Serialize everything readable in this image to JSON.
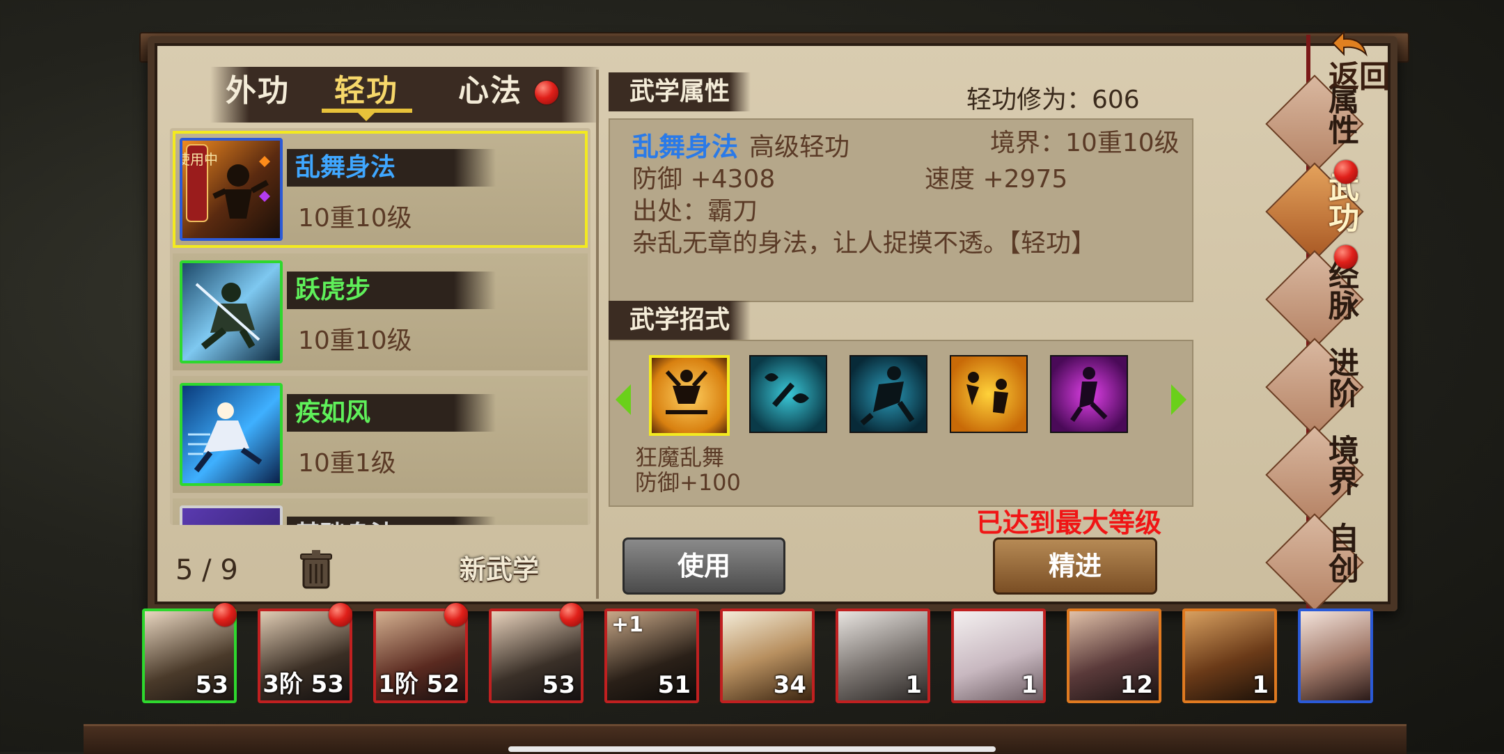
{
  "tabs": [
    {
      "label": "外功"
    },
    {
      "label": "轻功"
    },
    {
      "label": "心法"
    }
  ],
  "skill_list": [
    {
      "name": "乱舞身法",
      "level": "10重10级",
      "name_color": "#3fa7ff",
      "badge": "使用中",
      "selected": true
    },
    {
      "name": "跃虎步",
      "level": "10重10级",
      "name_color": "#5ff05a"
    },
    {
      "name": "疾如风",
      "level": "10重1级",
      "name_color": "#5ff05a"
    },
    {
      "name": "基础身法",
      "level": "",
      "name_color": "#d6d6d6"
    }
  ],
  "list_footer": {
    "count": "5 / 9",
    "new_button": "新武学"
  },
  "attributes": {
    "section_title": "武学属性",
    "cultivation": "轻功修为：606",
    "name": "乱舞身法",
    "grade": "高级轻功",
    "realm": "境界：10重10级",
    "defense": "防御 +4308",
    "speed": "速度 +2975",
    "source": "出处：霸刀",
    "description": "杂乱无章的身法，让人捉摸不透。【轻功】"
  },
  "moves": {
    "section_title": "武学招式",
    "selected_name": "狂魔乱舞",
    "selected_effect": "防御+100",
    "icons": [
      "meditation-move-icon",
      "butterfly-move-icon",
      "dash-move-icon",
      "leap-move-icon",
      "dance-move-icon"
    ]
  },
  "actions": {
    "use": "使用",
    "refine": "精进",
    "max_level": "已达到最大等级"
  },
  "side_menu": [
    {
      "label": "属性"
    },
    {
      "label": "武功",
      "active": true
    },
    {
      "label": "经脉"
    },
    {
      "label": "进阶"
    },
    {
      "label": "境界"
    },
    {
      "label": "自创"
    }
  ],
  "back": "返回",
  "roster": [
    {
      "level": "53",
      "badge": "",
      "dot": true,
      "frame": "#2ed82e"
    },
    {
      "level": "3阶 53",
      "badge": "",
      "dot": true,
      "frame": "#c02020"
    },
    {
      "level": "1阶 52",
      "badge": "",
      "dot": true,
      "frame": "#c02020"
    },
    {
      "level": "53",
      "badge": "",
      "dot": true,
      "frame": "#c02020"
    },
    {
      "level": "51",
      "badge": "+1",
      "dot": false,
      "frame": "#c02020"
    },
    {
      "level": "34",
      "badge": "",
      "dot": false,
      "frame": "#c02020"
    },
    {
      "level": "1",
      "badge": "",
      "dot": false,
      "frame": "#c02020"
    },
    {
      "level": "1",
      "badge": "",
      "dot": false,
      "frame": "#c02020"
    },
    {
      "level": "12",
      "badge": "",
      "dot": false,
      "frame": "#e07a20"
    },
    {
      "level": "1",
      "badge": "",
      "dot": false,
      "frame": "#e07a20"
    },
    {
      "level": "",
      "badge": "",
      "dot": false,
      "frame": "#2a5ad8"
    }
  ]
}
